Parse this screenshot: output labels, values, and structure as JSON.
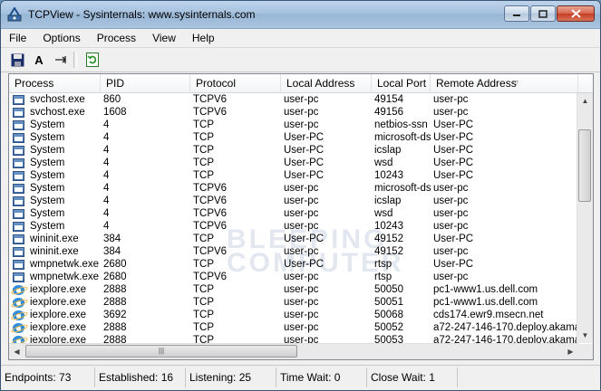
{
  "window": {
    "title": "TCPView - Sysinternals: www.sysinternals.com"
  },
  "menu": [
    "File",
    "Options",
    "Process",
    "View",
    "Help"
  ],
  "toolbar": {
    "font_label": "A",
    "icons": [
      "save-icon",
      "font-icon",
      "resolve-icon",
      "refresh-icon"
    ]
  },
  "columns": [
    "Process",
    "PID",
    "Protocol",
    "Local Address",
    "Local Port",
    "Remote Address"
  ],
  "rows": [
    {
      "icon": "win",
      "process": "svchost.exe",
      "pid": "860",
      "protocol": "TCPV6",
      "local_address": "user-pc",
      "local_port": "49154",
      "remote_address": "user-pc"
    },
    {
      "icon": "win",
      "process": "svchost.exe",
      "pid": "1608",
      "protocol": "TCPV6",
      "local_address": "user-pc",
      "local_port": "49156",
      "remote_address": "user-pc"
    },
    {
      "icon": "win",
      "process": "System",
      "pid": "4",
      "protocol": "TCP",
      "local_address": "user-pc",
      "local_port": "netbios-ssn",
      "remote_address": "User-PC"
    },
    {
      "icon": "win",
      "process": "System",
      "pid": "4",
      "protocol": "TCP",
      "local_address": "User-PC",
      "local_port": "microsoft-ds",
      "remote_address": "User-PC"
    },
    {
      "icon": "win",
      "process": "System",
      "pid": "4",
      "protocol": "TCP",
      "local_address": "User-PC",
      "local_port": "icslap",
      "remote_address": "User-PC"
    },
    {
      "icon": "win",
      "process": "System",
      "pid": "4",
      "protocol": "TCP",
      "local_address": "User-PC",
      "local_port": "wsd",
      "remote_address": "User-PC"
    },
    {
      "icon": "win",
      "process": "System",
      "pid": "4",
      "protocol": "TCP",
      "local_address": "User-PC",
      "local_port": "10243",
      "remote_address": "User-PC"
    },
    {
      "icon": "win",
      "process": "System",
      "pid": "4",
      "protocol": "TCPV6",
      "local_address": "user-pc",
      "local_port": "microsoft-ds",
      "remote_address": "user-pc"
    },
    {
      "icon": "win",
      "process": "System",
      "pid": "4",
      "protocol": "TCPV6",
      "local_address": "user-pc",
      "local_port": "icslap",
      "remote_address": "user-pc"
    },
    {
      "icon": "win",
      "process": "System",
      "pid": "4",
      "protocol": "TCPV6",
      "local_address": "user-pc",
      "local_port": "wsd",
      "remote_address": "user-pc"
    },
    {
      "icon": "win",
      "process": "System",
      "pid": "4",
      "protocol": "TCPV6",
      "local_address": "user-pc",
      "local_port": "10243",
      "remote_address": "user-pc"
    },
    {
      "icon": "win",
      "process": "wininit.exe",
      "pid": "384",
      "protocol": "TCP",
      "local_address": "User-PC",
      "local_port": "49152",
      "remote_address": "User-PC"
    },
    {
      "icon": "win",
      "process": "wininit.exe",
      "pid": "384",
      "protocol": "TCPV6",
      "local_address": "user-pc",
      "local_port": "49152",
      "remote_address": "user-pc"
    },
    {
      "icon": "win",
      "process": "wmpnetwk.exe",
      "pid": "2680",
      "protocol": "TCP",
      "local_address": "User-PC",
      "local_port": "rtsp",
      "remote_address": "User-PC"
    },
    {
      "icon": "win",
      "process": "wmpnetwk.exe",
      "pid": "2680",
      "protocol": "TCPV6",
      "local_address": "user-pc",
      "local_port": "rtsp",
      "remote_address": "user-pc"
    },
    {
      "icon": "ie",
      "process": "iexplore.exe",
      "pid": "2888",
      "protocol": "TCP",
      "local_address": "user-pc",
      "local_port": "50050",
      "remote_address": "pc1-www1.us.dell.com"
    },
    {
      "icon": "ie",
      "process": "iexplore.exe",
      "pid": "2888",
      "protocol": "TCP",
      "local_address": "user-pc",
      "local_port": "50051",
      "remote_address": "pc1-www1.us.dell.com"
    },
    {
      "icon": "ie",
      "process": "iexplore.exe",
      "pid": "3692",
      "protocol": "TCP",
      "local_address": "user-pc",
      "local_port": "50068",
      "remote_address": "cds174.ewr9.msecn.net"
    },
    {
      "icon": "ie",
      "process": "iexplore.exe",
      "pid": "2888",
      "protocol": "TCP",
      "local_address": "user-pc",
      "local_port": "50052",
      "remote_address": "a72-247-146-170.deploy.akamai..."
    },
    {
      "icon": "ie",
      "process": "iexplore.exe",
      "pid": "2888",
      "protocol": "TCP",
      "local_address": "user-pc",
      "local_port": "50053",
      "remote_address": "a72-247-146-170.deploy.akamai..."
    }
  ],
  "status": [
    "Endpoints: 73",
    "Established: 16",
    "Listening: 25",
    "Time Wait: 0",
    "Close Wait: 1"
  ],
  "watermark": [
    "BLEEPING",
    "COMPUTER"
  ]
}
